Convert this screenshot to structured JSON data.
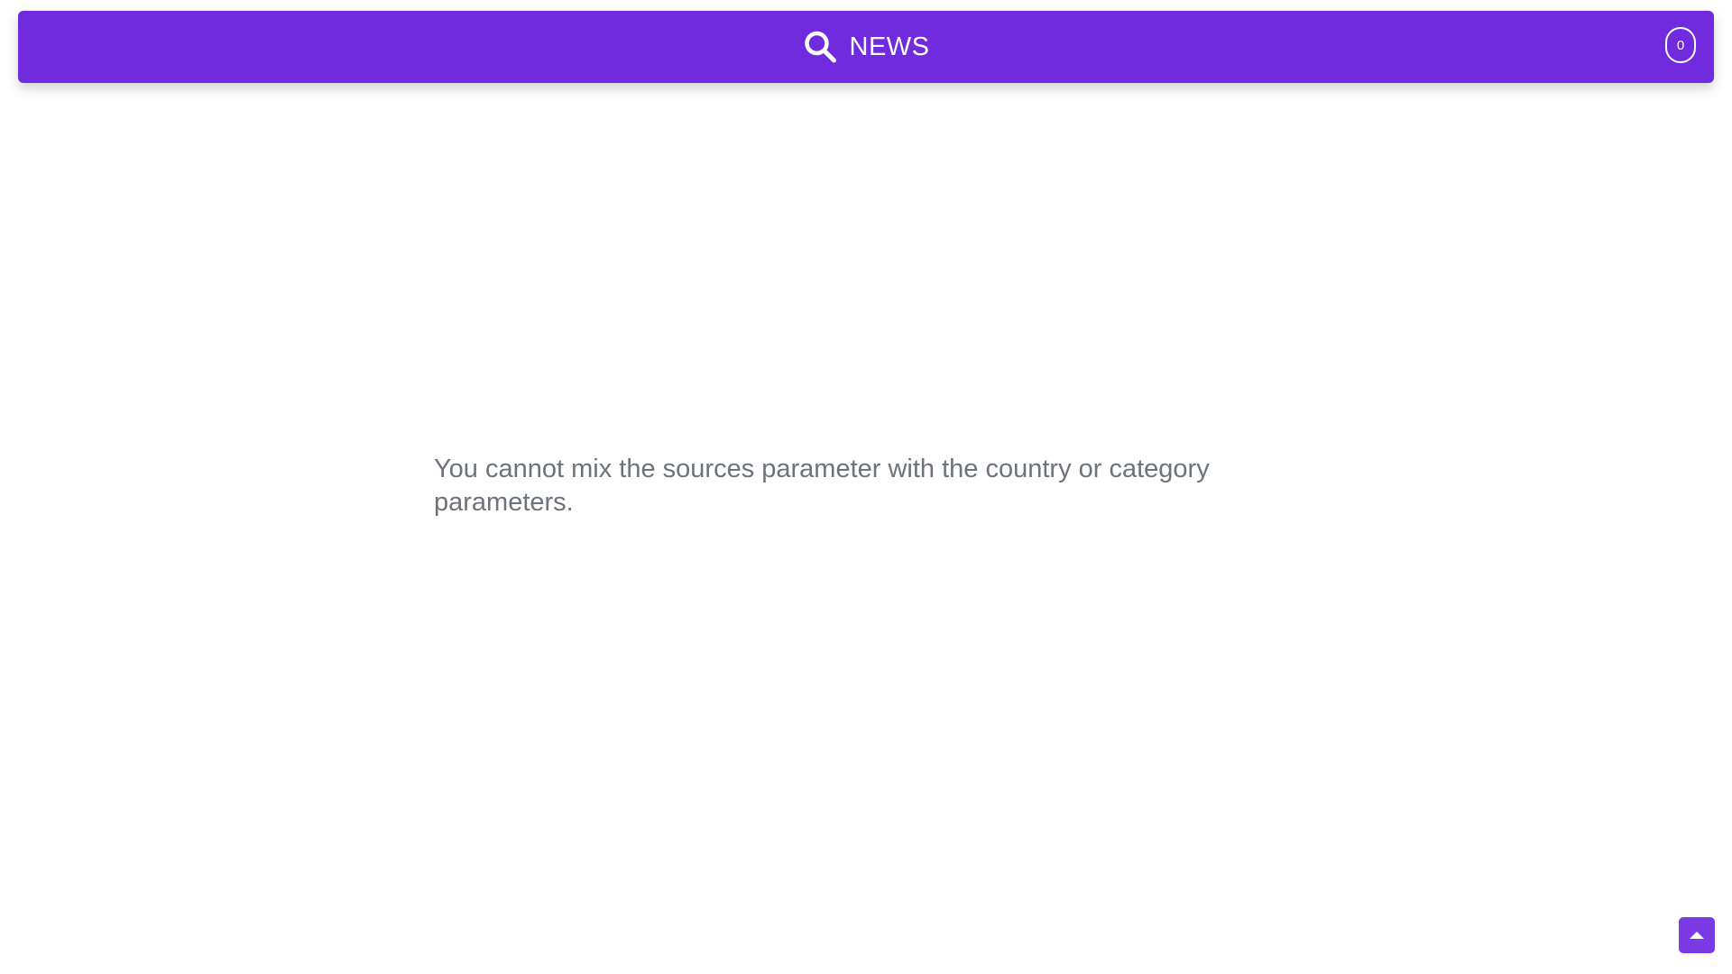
{
  "header": {
    "title": "NEWS",
    "brand_icon": "search-icon",
    "counter_value": "0",
    "background_color": "#6f2bdd"
  },
  "main": {
    "error_message": "You cannot mix the sources parameter with the country or category parameters."
  },
  "scroll_top": {
    "icon": "caret-up-icon",
    "background_color": "#7a3ae6"
  }
}
